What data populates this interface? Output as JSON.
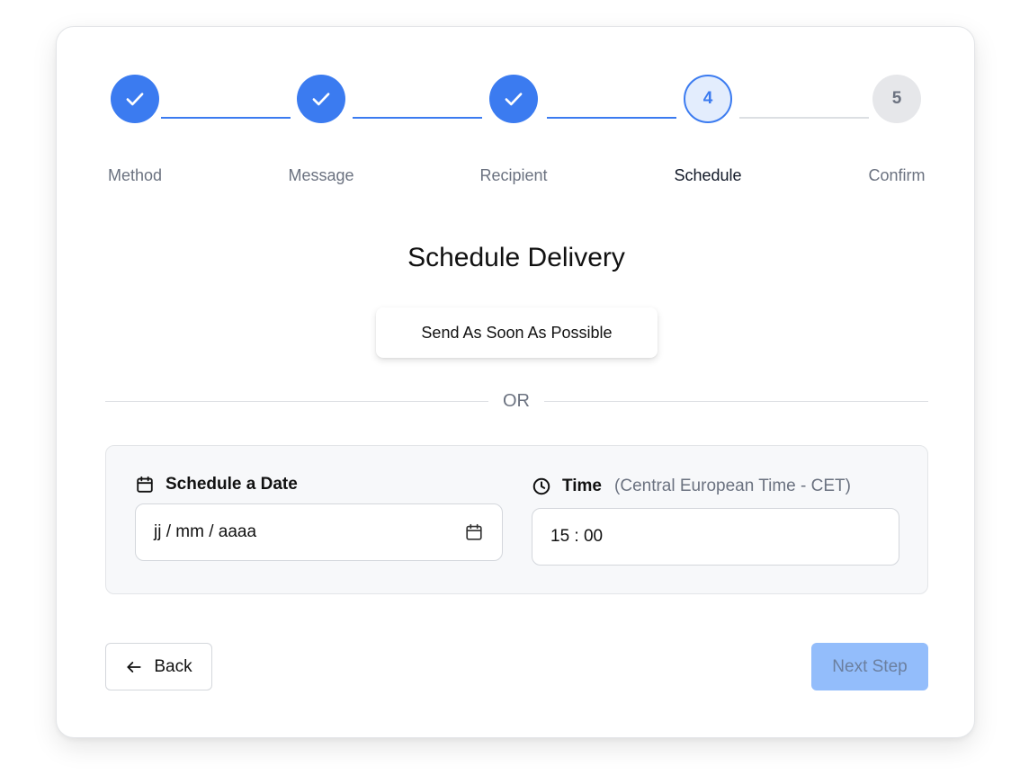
{
  "stepper": {
    "steps": [
      {
        "label": "Method",
        "state": "done",
        "number": ""
      },
      {
        "label": "Message",
        "state": "done",
        "number": ""
      },
      {
        "label": "Recipient",
        "state": "done",
        "number": ""
      },
      {
        "label": "Schedule",
        "state": "active",
        "number": "4"
      },
      {
        "label": "Confirm",
        "state": "pending",
        "number": "5"
      }
    ]
  },
  "main": {
    "title": "Schedule Delivery",
    "asap_label": "Send As Soon As Possible",
    "or_label": "OR"
  },
  "schedule": {
    "date_label": "Schedule a Date",
    "date_value": "jj / mm / aaaa",
    "time_label": "Time",
    "time_hint": "(Central European Time - CET)",
    "time_value": "15 : 00"
  },
  "footer": {
    "back_label": "Back",
    "next_label": "Next Step",
    "next_enabled": false
  },
  "colors": {
    "accent": "#3b7bf0",
    "accent_light": "#e3edfd",
    "pending": "#e6e7ea",
    "next_disabled": "#93bdfb"
  },
  "icons": [
    "check-icon",
    "calendar-icon",
    "clock-icon",
    "arrow-left-icon"
  ]
}
